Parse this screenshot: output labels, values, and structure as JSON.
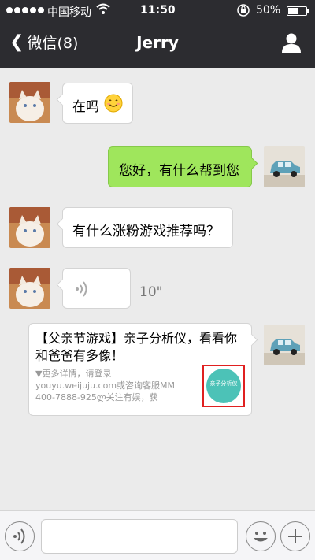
{
  "status_bar": {
    "carrier": "中国移动",
    "time": "11:50",
    "battery": "50%"
  },
  "nav": {
    "back_label": "微信(8)",
    "title": "Jerry"
  },
  "messages": [
    {
      "from": "other",
      "type": "text",
      "text": "在吗"
    },
    {
      "from": "self",
      "type": "text",
      "text": "您好，有什么帮到您"
    },
    {
      "from": "other",
      "type": "text",
      "text": "有什么涨粉游戏推荐吗？"
    },
    {
      "from": "other",
      "type": "voice",
      "duration": "10\""
    },
    {
      "from": "self",
      "type": "link-card",
      "title": "【父亲节游戏】亲子分析仪，看看你和爸爸有多像！",
      "detail_lines": [
        "▼更多详情，请登录",
        "youyu.weijuju.com或咨询客服MM",
        "400-7888-925ლ关注有娱，获"
      ],
      "thumb_text": "亲子分析仪"
    }
  ],
  "colors": {
    "nav_bg": "#2c2c30",
    "chat_bg": "#ebebeb",
    "self_bubble": "#9fe65c",
    "highlight": "#e02020",
    "thumb": "#4cc2b7"
  }
}
